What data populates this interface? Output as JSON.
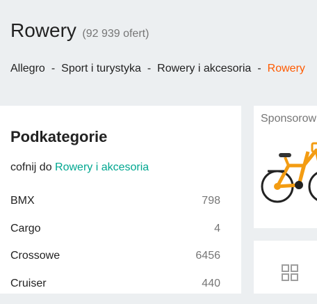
{
  "header": {
    "title": "Rowery",
    "offer_count": "(92 939 ofert)"
  },
  "breadcrumb": {
    "items": [
      "Allegro",
      "Sport i turystyka",
      "Rowery i akcesoria",
      "Rowery"
    ],
    "separator": "-",
    "current_color": "#ff5a00"
  },
  "subcategories": {
    "title": "Podkategorie",
    "back_prefix": "cofnij do",
    "back_link": "Rowery i akcesoria",
    "items": [
      {
        "name": "BMX",
        "count": "798"
      },
      {
        "name": "Cargo",
        "count": "4"
      },
      {
        "name": "Crossowe",
        "count": "6456"
      },
      {
        "name": "Cruiser",
        "count": "440"
      }
    ]
  },
  "sponsored": {
    "label": "Sponsorow",
    "image_icon": "bike-icon"
  },
  "view_toggle": {
    "icon": "grid-icon"
  },
  "colors": {
    "accent": "#ff5a00",
    "link": "#00a790",
    "muted": "#767676",
    "background": "#eceff1"
  }
}
